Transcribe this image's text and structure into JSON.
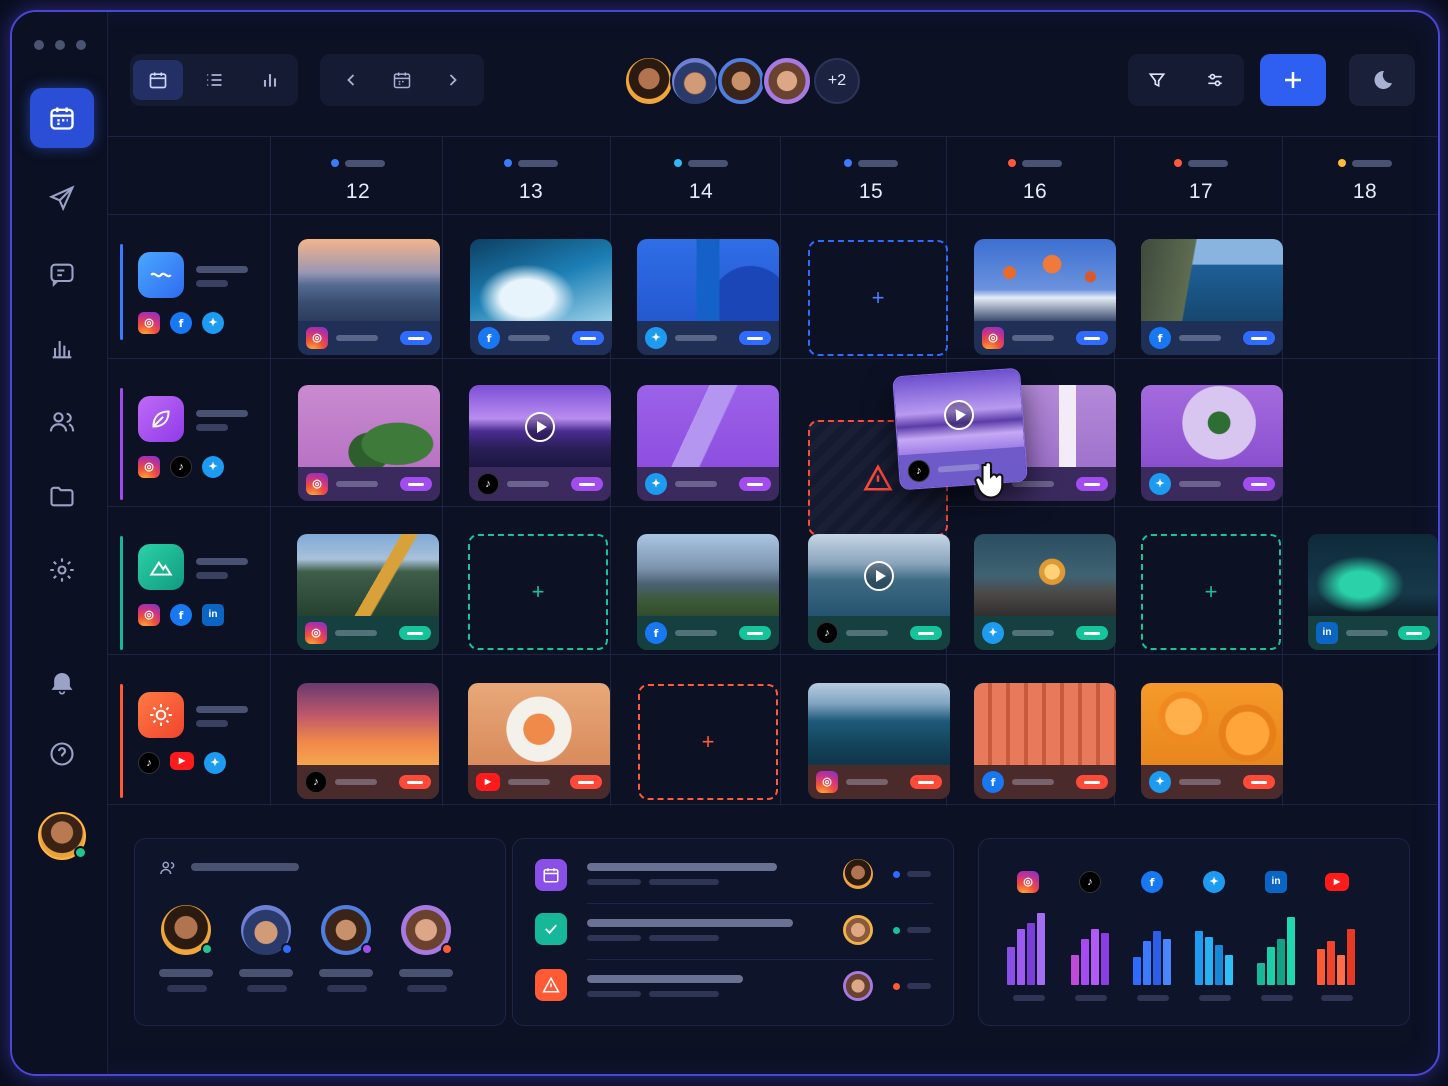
{
  "topbar": {
    "more_count": "+2"
  },
  "days": [
    {
      "num": "12",
      "color": "#3b7bff"
    },
    {
      "num": "13",
      "color": "#3b7bff"
    },
    {
      "num": "14",
      "color": "#30b8ff"
    },
    {
      "num": "15",
      "color": "#3b7bff"
    },
    {
      "num": "16",
      "color": "#ff5a3c"
    },
    {
      "num": "17",
      "color": "#ff5a3c"
    },
    {
      "num": "18",
      "color": "#ffb93b"
    }
  ],
  "brands": [
    {
      "accent": "#3b7bff",
      "socials": [
        "instagram",
        "facebook",
        "twitter"
      ]
    },
    {
      "accent": "#a24cf0",
      "socials": [
        "instagram",
        "tiktok",
        "twitter"
      ]
    },
    {
      "accent": "#17b899",
      "socials": [
        "instagram",
        "facebook",
        "linkedin"
      ]
    },
    {
      "accent": "#ff5a36",
      "socials": [
        "tiktok",
        "youtube",
        "twitter"
      ]
    }
  ],
  "colors": {
    "blue_tag": "#2f6bff",
    "purple_tag": "#a24cf0",
    "teal_tag": "#17c39a",
    "orange_tag": "#ff4a3a",
    "accent": "#2f5ff0"
  },
  "chart_platforms": [
    "instagram",
    "tiktok",
    "facebook",
    "twitter",
    "linkedin",
    "youtube"
  ]
}
